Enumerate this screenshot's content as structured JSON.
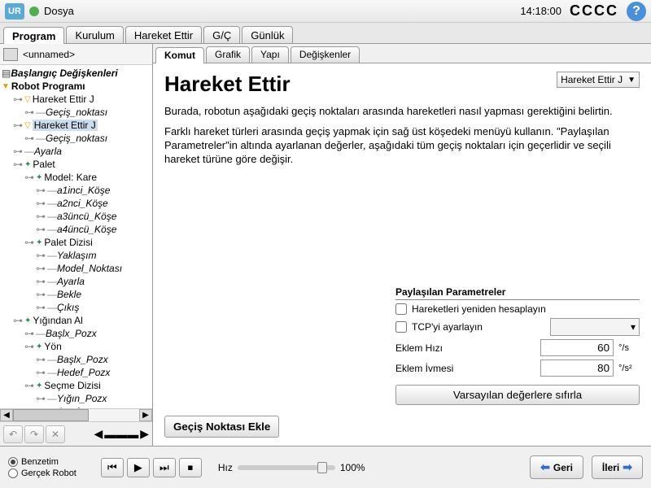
{
  "topbar": {
    "title": "Dosya",
    "time": "14:18:00",
    "cccc": "CCCC"
  },
  "main_tabs": [
    "Program",
    "Kurulum",
    "Hareket Ettir",
    "G/Ç",
    "Günlük"
  ],
  "main_tab_active": 0,
  "file_name": "<unnamed>",
  "tree": [
    {
      "d": 0,
      "t": "header",
      "label": "Başlangıç Değişkenleri"
    },
    {
      "d": 0,
      "t": "root",
      "label": "Robot Programı"
    },
    {
      "d": 1,
      "t": "move",
      "label": "Hareket Ettir J"
    },
    {
      "d": 2,
      "t": "wp",
      "label": "Geçiş_noktası"
    },
    {
      "d": 1,
      "t": "move",
      "label": "Hareket Ettir J",
      "sel": true
    },
    {
      "d": 2,
      "t": "wp",
      "label": "Geçiş_noktası"
    },
    {
      "d": 1,
      "t": "cmd",
      "label": "Ayarla"
    },
    {
      "d": 1,
      "t": "grp",
      "label": "Palet"
    },
    {
      "d": 2,
      "t": "grp",
      "label": "Model: Kare"
    },
    {
      "d": 3,
      "t": "cmd",
      "label": "a1inci_Köşe"
    },
    {
      "d": 3,
      "t": "cmd",
      "label": "a2nci_Köşe"
    },
    {
      "d": 3,
      "t": "cmd",
      "label": "a3üncü_Köşe"
    },
    {
      "d": 3,
      "t": "cmd",
      "label": "a4üncü_Köşe"
    },
    {
      "d": 2,
      "t": "grp",
      "label": "Palet Dizisi"
    },
    {
      "d": 3,
      "t": "cmd",
      "label": "Yaklaşım"
    },
    {
      "d": 3,
      "t": "cmd",
      "label": "Model_Noktası"
    },
    {
      "d": 3,
      "t": "cmd",
      "label": "Ayarla"
    },
    {
      "d": 3,
      "t": "cmd",
      "label": "Bekle"
    },
    {
      "d": 3,
      "t": "cmd",
      "label": "Çıkış"
    },
    {
      "d": 1,
      "t": "grp",
      "label": "Yığından Al"
    },
    {
      "d": 2,
      "t": "cmd",
      "label": "Başlx_Pozx"
    },
    {
      "d": 2,
      "t": "grp",
      "label": "Yön"
    },
    {
      "d": 3,
      "t": "cmd",
      "label": "Başlx_Pozx"
    },
    {
      "d": 3,
      "t": "cmd",
      "label": "Hedef_Pozx"
    },
    {
      "d": 2,
      "t": "grp",
      "label": "Seçme Dizisi"
    },
    {
      "d": 3,
      "t": "cmd",
      "label": "Yığın_Pozx"
    },
    {
      "d": 3,
      "t": "cmd",
      "label": "Ayarla"
    }
  ],
  "sub_tabs": [
    "Komut",
    "Grafik",
    "Yapı",
    "Değişkenler"
  ],
  "sub_tab_active": 0,
  "command": {
    "title": "Hareket Ettir",
    "move_type": "Hareket Ettir J",
    "p1": "Burada, robotun aşağıdaki geçiş noktaları arasında hareketleri nasıl yapması gerektiğini belirtin.",
    "p2": "Farklı hareket türleri arasında geçiş yapmak için sağ üst köşedeki menüyü kullanın. \"Paylaşılan Parametreler\"in altında ayarlanan değerler, aşağıdaki tüm geçiş noktaları için geçerlidir ve seçili hareket türüne göre değişir.",
    "params_header": "Paylaşılan Parametreler",
    "recalc_label": "Hareketleri yeniden hesaplayın",
    "tcp_label": "TCP'yi ayarlayın",
    "speed_label": "Eklem Hızı",
    "speed_val": "60",
    "speed_unit": "°/s",
    "accel_label": "Eklem İvmesi",
    "accel_val": "80",
    "accel_unit": "°/s²",
    "reset_label": "Varsayılan değerlere sıfırla",
    "add_wp": "Geçiş Noktası Ekle"
  },
  "bottom": {
    "sim": "Benzetim",
    "real": "Gerçek Robot",
    "speed_label": "Hız",
    "speed_pct": "100%",
    "back": "Geri",
    "next": "İleri"
  }
}
